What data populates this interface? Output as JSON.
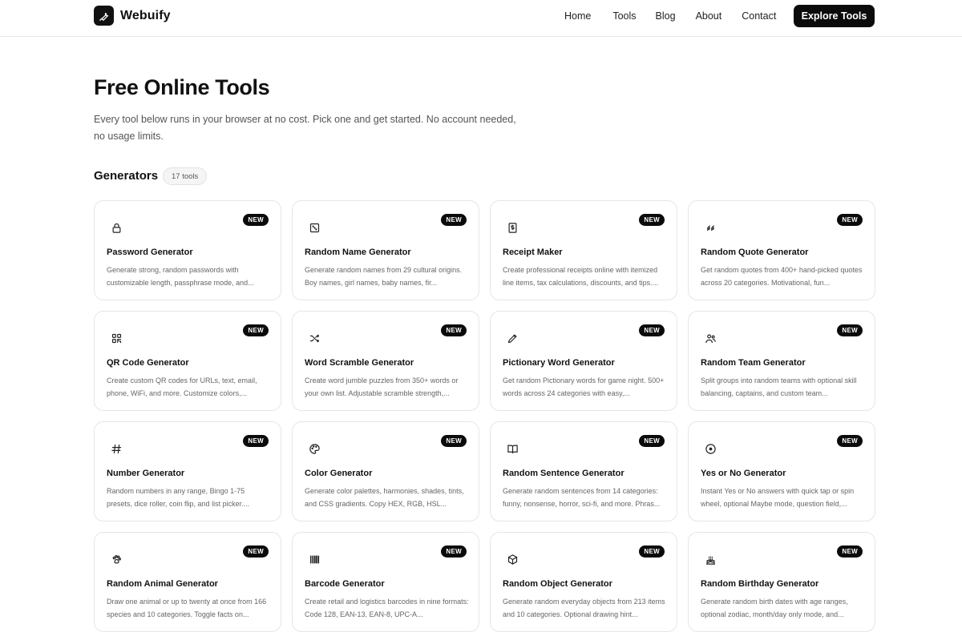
{
  "brand": {
    "name": "Webuify",
    "icon": "wrench-icon"
  },
  "nav": {
    "items": [
      "Home",
      "Tools",
      "Blog",
      "About",
      "Contact"
    ],
    "cta_label": "Explore Tools"
  },
  "hero": {
    "title": "Free Online Tools",
    "subtitle": "Every tool below runs in your browser at no cost. Pick one and get started. No account needed, no usage limits."
  },
  "section": {
    "title": "Generators",
    "count": "17 tools"
  },
  "cards": [
    {
      "icon": "lock-icon",
      "badge": "NEW",
      "title": "Password Generator",
      "desc": "Generate strong, random passwords with customizable length, passphrase mode, and..."
    },
    {
      "icon": "dice-icon",
      "badge": "NEW",
      "title": "Random Name Generator",
      "desc": "Generate random names from 29 cultural origins. Boy names, girl names, baby names, fir..."
    },
    {
      "icon": "receipt-icon",
      "badge": "NEW",
      "title": "Receipt Maker",
      "desc": "Create professional receipts online with itemized line items, tax calculations, discounts, and tips...."
    },
    {
      "icon": "quote-icon",
      "badge": "NEW",
      "title": "Random Quote Generator",
      "desc": "Get random quotes from 400+ hand-picked quotes across 20 categories. Motivational, fun..."
    },
    {
      "icon": "qr-code-icon",
      "badge": "NEW",
      "title": "QR Code Generator",
      "desc": "Create custom QR codes for URLs, text, email, phone, WiFi, and more. Customize colors,..."
    },
    {
      "icon": "shuffle-icon",
      "badge": "NEW",
      "title": "Word Scramble Generator",
      "desc": "Create word jumble puzzles from 350+ words or your own list. Adjustable scramble strength,..."
    },
    {
      "icon": "pencil-icon",
      "badge": "NEW",
      "title": "Pictionary Word Generator",
      "desc": "Get random Pictionary words for game night. 500+ words across 24 categories with easy,..."
    },
    {
      "icon": "users-icon",
      "badge": "NEW",
      "title": "Random Team Generator",
      "desc": "Split groups into random teams with optional skill balancing, captains, and custom team..."
    },
    {
      "icon": "hash-icon",
      "badge": "NEW",
      "title": "Number Generator",
      "desc": "Random numbers in any range, Bingo 1-75 presets, dice roller, coin flip, and list picker...."
    },
    {
      "icon": "palette-icon",
      "badge": "NEW",
      "title": "Color Generator",
      "desc": "Generate color palettes, harmonies, shades, tints, and CSS gradients. Copy HEX, RGB, HSL..."
    },
    {
      "icon": "book-open-icon",
      "badge": "NEW",
      "title": "Random Sentence Generator",
      "desc": "Generate random sentences from 14 categories: funny, nonsense, horror, sci-fi, and more. Phras..."
    },
    {
      "icon": "circle-dot-icon",
      "badge": "NEW",
      "title": "Yes or No Generator",
      "desc": "Instant Yes or No answers with quick tap or spin wheel, optional Maybe mode, question field,..."
    },
    {
      "icon": "paw-icon",
      "badge": "NEW",
      "title": "Random Animal Generator",
      "desc": "Draw one animal or up to twenty at once from 166 species and 10 categories. Toggle facts on..."
    },
    {
      "icon": "barcode-icon",
      "badge": "NEW",
      "title": "Barcode Generator",
      "desc": "Create retail and logistics barcodes in nine formats: Code 128, EAN-13, EAN-8, UPC-A..."
    },
    {
      "icon": "box-icon",
      "badge": "NEW",
      "title": "Random Object Generator",
      "desc": "Generate random everyday objects from 213 items and 10 categories. Optional drawing hint..."
    },
    {
      "icon": "cake-icon",
      "badge": "NEW",
      "title": "Random Birthday Generator",
      "desc": "Generate random birth dates with age ranges, optional zodiac, month/day only mode, and..."
    }
  ]
}
